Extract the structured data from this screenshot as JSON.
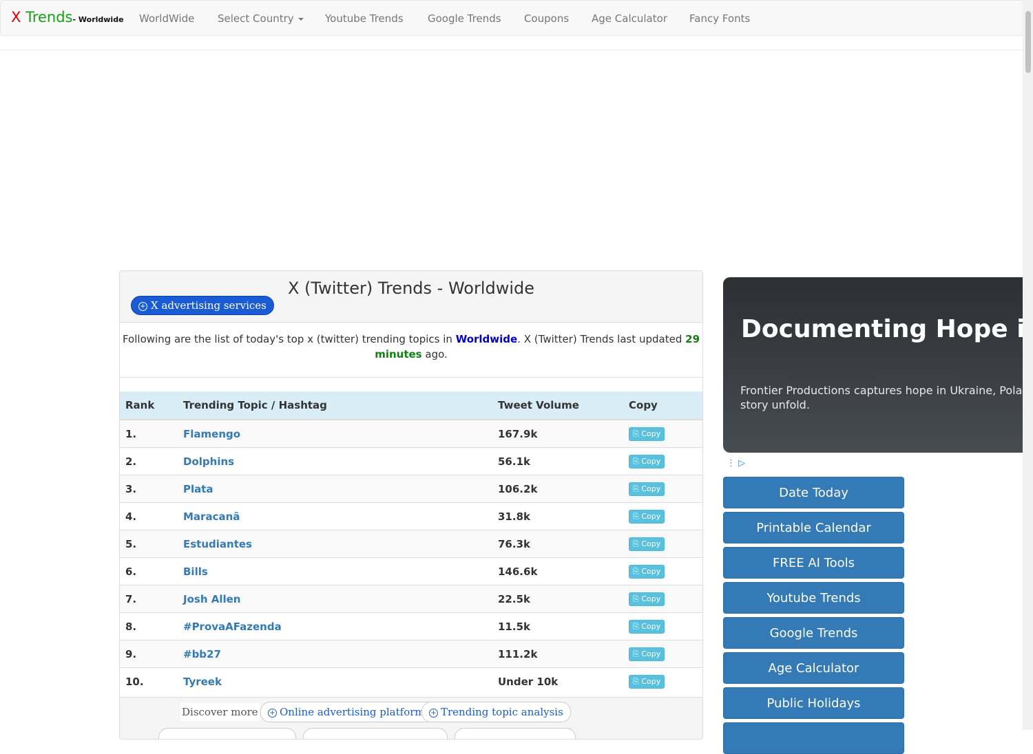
{
  "navbar": {
    "brand_x": "X",
    "brand_trends": "Trends",
    "brand_sub": "- Worldwide",
    "items": [
      "WorldWide",
      "Select Country",
      "Youtube Trends",
      "Google Trends",
      "Coupons",
      "Age Calculator",
      "Fancy Fonts"
    ]
  },
  "panel": {
    "title": "X (Twitter) Trends - Worldwide",
    "ad_pill": "X advertising services",
    "intro_a": "Following are the list of today's top x (twitter) trending topics in ",
    "intro_loc": "Worldwide",
    "intro_b": ". X (Twitter) Trends last updated ",
    "intro_upd": "29 minutes",
    "intro_c": " ago."
  },
  "table": {
    "headers": [
      "Rank",
      "Trending Topic / Hashtag",
      "Tweet Volume",
      "Copy"
    ],
    "rows": [
      {
        "rank": "1.",
        "topic": "Flamengo",
        "volume": "167.9k"
      },
      {
        "rank": "2.",
        "topic": "Dolphins",
        "volume": "56.1k"
      },
      {
        "rank": "3.",
        "topic": "Plata",
        "volume": "106.2k"
      },
      {
        "rank": "4.",
        "topic": "Maracanã",
        "volume": "31.8k"
      },
      {
        "rank": "5.",
        "topic": "Estudiantes",
        "volume": "76.3k"
      },
      {
        "rank": "6.",
        "topic": "Bills",
        "volume": "146.6k"
      },
      {
        "rank": "7.",
        "topic": "Josh Allen",
        "volume": "22.5k"
      },
      {
        "rank": "8.",
        "topic": "#ProvaAFazenda",
        "volume": "11.5k"
      },
      {
        "rank": "9.",
        "topic": "#bb27",
        "volume": "111.2k"
      },
      {
        "rank": "10.",
        "topic": "Tyreek",
        "volume": "Under 10k"
      }
    ],
    "copy_label": "Copy"
  },
  "discover": {
    "label": "Discover more",
    "pills": [
      "Online advertising platforms",
      "Trending topic analysis"
    ]
  },
  "ad": {
    "title": "Documenting Hope in U",
    "desc": "Frontier Productions captures hope in Ukraine, Poland story unfold."
  },
  "sidebar": {
    "buttons": [
      "Date Today",
      "Printable Calendar",
      "FREE AI Tools",
      "Youtube Trends",
      "Google Trends",
      "Age Calculator",
      "Public Holidays"
    ]
  }
}
